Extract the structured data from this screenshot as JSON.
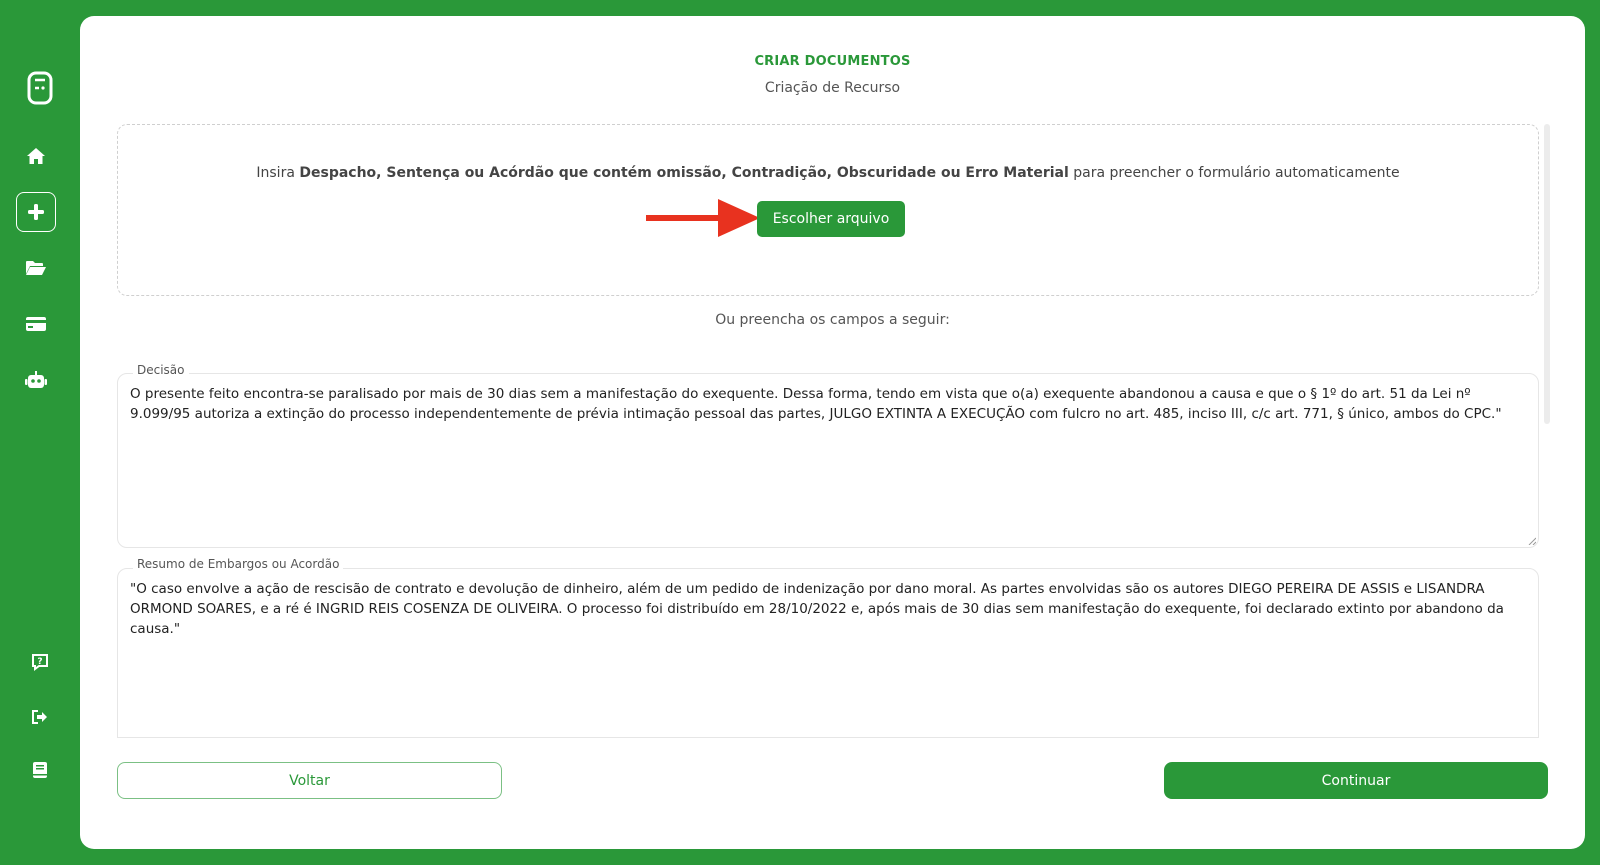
{
  "sidebar": {
    "items": [
      {
        "icon": "logo-icon"
      },
      {
        "icon": "home-icon"
      },
      {
        "icon": "plus-icon"
      },
      {
        "icon": "folder-open-icon"
      },
      {
        "icon": "credit-card-icon"
      },
      {
        "icon": "robot-icon"
      },
      {
        "icon": "help-icon"
      },
      {
        "icon": "logout-icon"
      },
      {
        "icon": "book-icon"
      }
    ]
  },
  "header": {
    "title": "CRIAR DOCUMENTOS",
    "subtitle": "Criação de Recurso"
  },
  "upload": {
    "text_prefix": "Insira ",
    "text_bold": "Despacho, Sentença ou Acórdão que contém omissão, Contradição, Obscuridade ou Erro Material",
    "text_suffix": " para preencher o formulário automaticamente",
    "button_label": "Escolher arquivo"
  },
  "or_text": "Ou preencha os campos a seguir:",
  "fields": {
    "decisao": {
      "label": "Decisão",
      "value": "O presente feito encontra-se paralisado por mais de 30 dias sem a manifestação do exequente. Dessa forma, tendo em vista que o(a) exequente abandonou a causa e que o § 1º do art. 51 da Lei nº 9.099/95 autoriza a extinção do processo independentemente de prévia intimação pessoal das partes, JULGO EXTINTA A EXECUÇÃO com fulcro no art. 485, inciso III, c/c art. 771, § único, ambos do CPC.\""
    },
    "resumo": {
      "label": "Resumo de Embargos ou Acordão",
      "value": " \"O caso envolve a ação de rescisão de contrato e devolução de dinheiro, além de um pedido de indenização por dano moral. As partes envolvidas são os autores DIEGO PEREIRA DE ASSIS e LISANDRA ORMOND SOARES, e a ré é INGRID REIS COSENZA DE OLIVEIRA. O processo foi distribuído em 28/10/2022 e, após mais de 30 dias sem manifestação do exequente, foi declarado extinto por abandono da causa.\""
    }
  },
  "footer": {
    "back_label": "Voltar",
    "continue_label": "Continuar"
  },
  "colors": {
    "brand": "#2a9839",
    "arrow": "#e8321f"
  }
}
